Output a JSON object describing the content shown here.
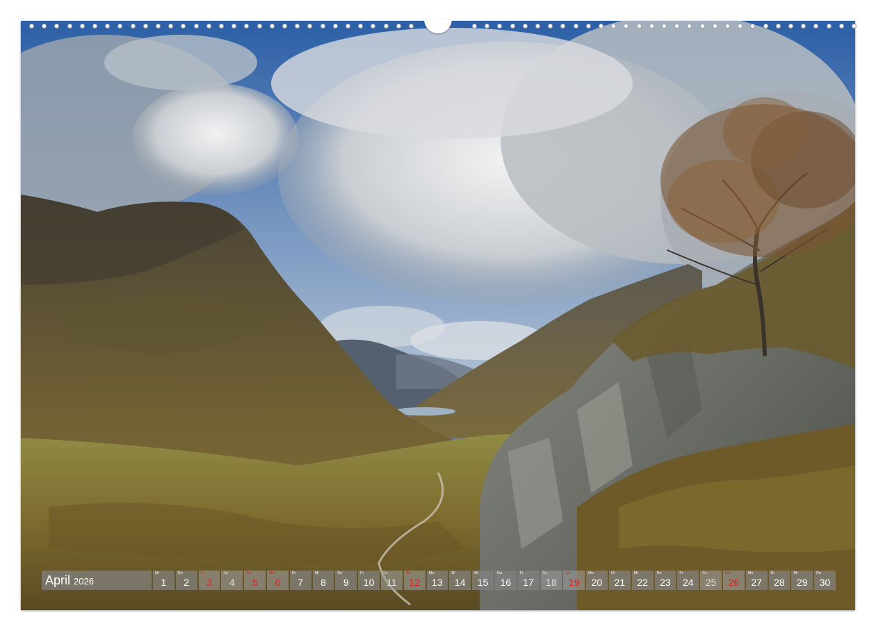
{
  "calendar": {
    "month": "April",
    "year": "2026",
    "days": [
      {
        "num": "1",
        "wd": "Mi",
        "type": "normal"
      },
      {
        "num": "2",
        "wd": "Do",
        "type": "normal"
      },
      {
        "num": "3",
        "wd": "Fr",
        "type": "holiday"
      },
      {
        "num": "4",
        "wd": "Sa",
        "type": "weekend"
      },
      {
        "num": "5",
        "wd": "So",
        "type": "holiday"
      },
      {
        "num": "6",
        "wd": "Mo",
        "type": "holiday"
      },
      {
        "num": "7",
        "wd": "Di",
        "type": "normal"
      },
      {
        "num": "8",
        "wd": "Mi",
        "type": "normal"
      },
      {
        "num": "9",
        "wd": "Do",
        "type": "normal"
      },
      {
        "num": "10",
        "wd": "Fr",
        "type": "normal"
      },
      {
        "num": "11",
        "wd": "Sa",
        "type": "weekend"
      },
      {
        "num": "12",
        "wd": "So",
        "type": "holiday"
      },
      {
        "num": "13",
        "wd": "Mo",
        "type": "normal"
      },
      {
        "num": "14",
        "wd": "Di",
        "type": "normal"
      },
      {
        "num": "15",
        "wd": "Mi",
        "type": "normal"
      },
      {
        "num": "16",
        "wd": "Do",
        "type": "normal"
      },
      {
        "num": "17",
        "wd": "Fr",
        "type": "normal"
      },
      {
        "num": "18",
        "wd": "Sa",
        "type": "weekend"
      },
      {
        "num": "19",
        "wd": "So",
        "type": "holiday"
      },
      {
        "num": "20",
        "wd": "Mo",
        "type": "normal"
      },
      {
        "num": "21",
        "wd": "Di",
        "type": "normal"
      },
      {
        "num": "22",
        "wd": "Mi",
        "type": "normal"
      },
      {
        "num": "23",
        "wd": "Do",
        "type": "normal"
      },
      {
        "num": "24",
        "wd": "Fr",
        "type": "normal"
      },
      {
        "num": "25",
        "wd": "Sa",
        "type": "weekend"
      },
      {
        "num": "26",
        "wd": "So",
        "type": "holiday"
      },
      {
        "num": "27",
        "wd": "Mo",
        "type": "normal"
      },
      {
        "num": "28",
        "wd": "Di",
        "type": "normal"
      },
      {
        "num": "29",
        "wd": "Mi",
        "type": "normal"
      },
      {
        "num": "30",
        "wd": "Do",
        "type": "normal"
      }
    ]
  },
  "colors": {
    "cell": "#828282",
    "holiday_text": "#d8231f",
    "sky": "#2f63a8",
    "moor": "#8a7a3a"
  }
}
